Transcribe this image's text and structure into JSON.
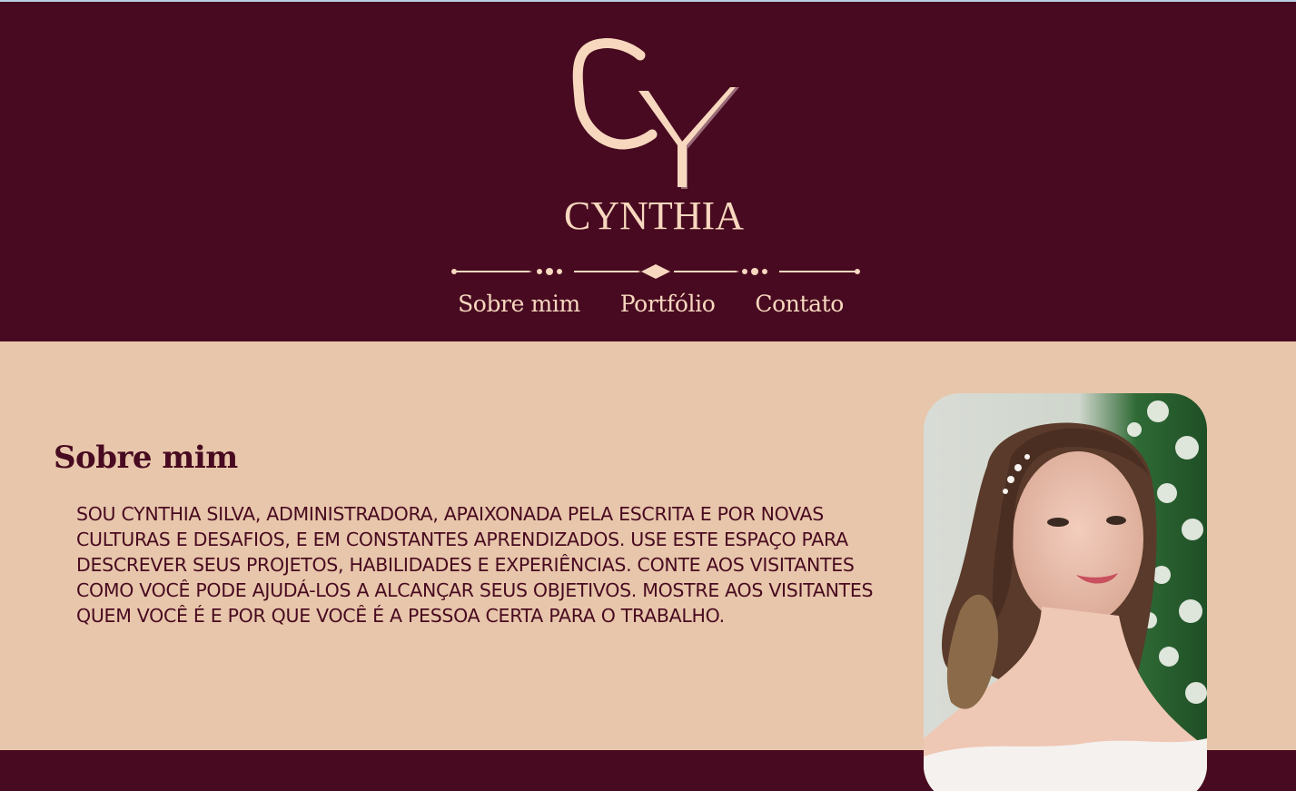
{
  "brand": {
    "monogram": "CY",
    "name": "CYNTHIA"
  },
  "nav": {
    "items": [
      {
        "label": "Sobre mim"
      },
      {
        "label": "Portfólio"
      },
      {
        "label": "Contato"
      }
    ]
  },
  "about": {
    "heading": "Sobre mim",
    "text": "Sou Cynthia Silva, Administradora, apaixonada pela escrita e por novas culturas e desafios, e em constantes aprendizados. Use este espaço para descrever seus projetos, habilidades e experiências. Conte aos visitantes como você pode ajudá-los a alcançar seus objetivos. Mostre aos visitantes quem você é e por que você é a pessoa certa para o trabalho."
  },
  "colors": {
    "burgundy": "#480a20",
    "peach": "#e8c6ab",
    "cream": "#f7d8bf"
  }
}
